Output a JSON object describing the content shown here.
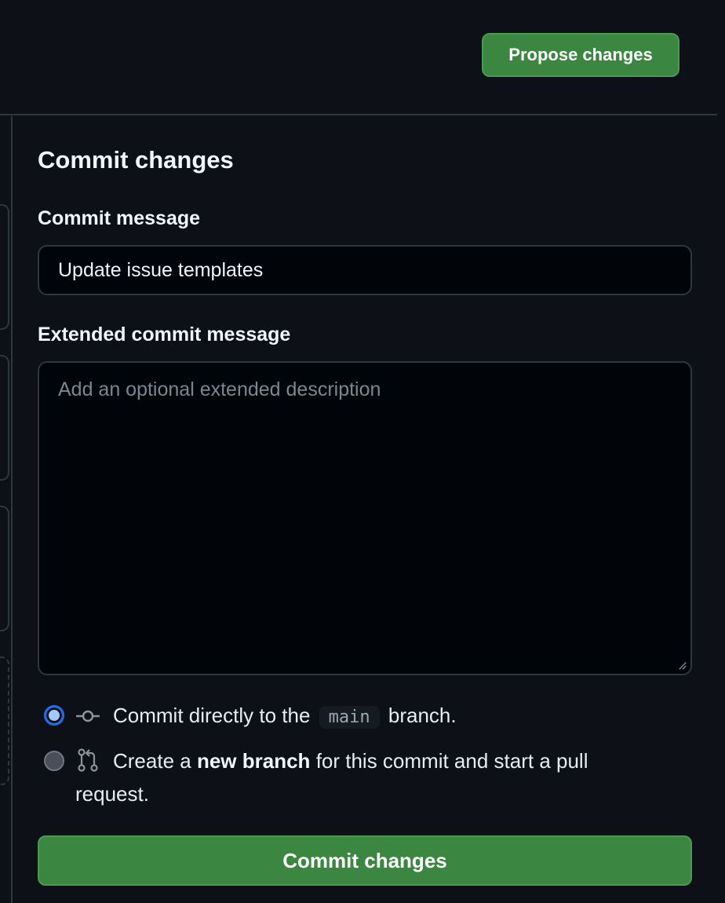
{
  "header": {
    "propose_label": "Propose changes"
  },
  "commit_panel": {
    "title": "Commit changes",
    "message_label": "Commit message",
    "message_value": "Update issue templates",
    "extended_label": "Extended commit message",
    "extended_placeholder": "Add an optional extended description",
    "options": [
      {
        "prefix": "Commit directly to the",
        "branch": "main",
        "suffix": "branch.",
        "selected": true,
        "icon": "git-commit-icon"
      },
      {
        "prefix": "Create a",
        "bold": "new branch",
        "suffix": "for this commit and start a pull",
        "continuation": "request.",
        "selected": false,
        "icon": "git-pull-request-icon"
      }
    ],
    "commit_button_label": "Commit changes"
  },
  "colors": {
    "background": "#0d1117",
    "input_bg": "#010409",
    "border": "#30363d",
    "primary_button": "#3b8640",
    "radio_selected": "#a5c8ff"
  }
}
